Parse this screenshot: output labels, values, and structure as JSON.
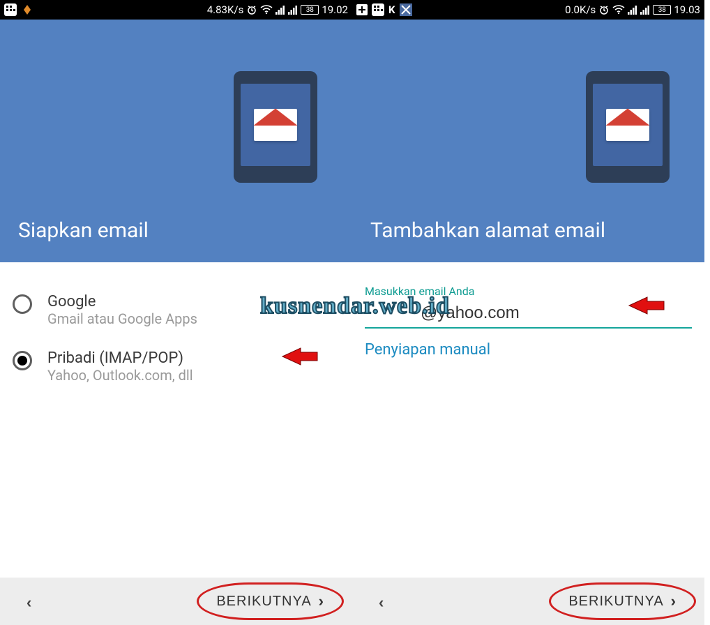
{
  "screens": {
    "left": {
      "statusbar": {
        "speed": "4.83K/s",
        "battery": "38",
        "time": "19.02"
      },
      "hero_title": "Siapkan email",
      "options": [
        {
          "title": "Google",
          "sub": "Gmail atau Google Apps",
          "selected": false
        },
        {
          "title": "Pribadi (IMAP/POP)",
          "sub": "Yahoo, Outlook.com, dll",
          "selected": true
        }
      ],
      "next_label": "BERIKUTNYA"
    },
    "right": {
      "statusbar": {
        "speed": "0.0K/s",
        "battery": "38",
        "time": "19.03"
      },
      "hero_title": "Tambahkan alamat email",
      "input_label": "Masukkan email Anda",
      "input_value": "@yahoo.com",
      "manual_link": "Penyiapan manual",
      "next_label": "BERIKUTNYA"
    }
  },
  "watermark": "kusnendar.web.id"
}
